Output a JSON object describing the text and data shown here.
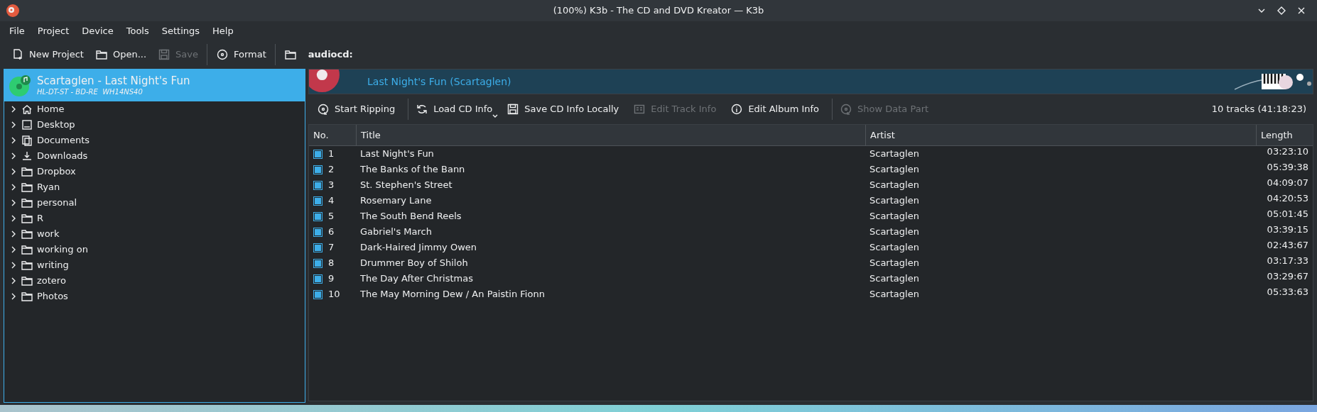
{
  "window": {
    "title": "(100%) K3b - The CD and DVD Kreator — K3b"
  },
  "menu": [
    "File",
    "Project",
    "Device",
    "Tools",
    "Settings",
    "Help"
  ],
  "toolbar": [
    {
      "label": "New Project",
      "disabled": false
    },
    {
      "label": "Open...",
      "disabled": false
    },
    {
      "label": "Save",
      "disabled": true
    },
    {
      "label": "Format",
      "disabled": false
    }
  ],
  "location": "audiocd:",
  "device": {
    "title": "Scartaglen - Last Night's Fun",
    "subtitle": "HL-DT-ST - BD-RE  WH14NS40",
    "selected": true
  },
  "tree": [
    {
      "label": "Home",
      "expanded": false
    },
    {
      "label": "Desktop",
      "expanded": false
    },
    {
      "label": "Documents",
      "expanded": false
    },
    {
      "label": "Downloads",
      "expanded": false
    },
    {
      "label": "Dropbox",
      "expanded": false
    },
    {
      "label": "Ryan",
      "expanded": false
    },
    {
      "label": "personal",
      "expanded": false
    },
    {
      "label": "R",
      "expanded": false
    },
    {
      "label": "work",
      "expanded": false
    },
    {
      "label": "working on",
      "expanded": false
    },
    {
      "label": "writing",
      "expanded": false
    },
    {
      "label": "zotero",
      "expanded": false
    },
    {
      "label": "Photos",
      "expanded": false
    }
  ],
  "banner": {
    "title": "Last Night's Fun (Scartaglen)"
  },
  "cd_toolbar": [
    {
      "label": "Start Ripping",
      "disabled": false,
      "menu": false
    },
    {
      "label": "Load CD Info",
      "disabled": false,
      "menu": true
    },
    {
      "label": "Save CD Info Locally",
      "disabled": false,
      "menu": false
    },
    {
      "label": "Edit Track Info",
      "disabled": true,
      "menu": false
    },
    {
      "label": "Edit Album Info",
      "disabled": false,
      "menu": false
    },
    {
      "label": "Show Data Part",
      "disabled": true,
      "menu": false
    }
  ],
  "summary": "10 tracks (41:18:23)",
  "table": {
    "columns": [
      "No.",
      "Title",
      "Artist",
      "Length"
    ],
    "rows": [
      {
        "checked": true,
        "no": "1",
        "title": "Last Night's Fun",
        "artist": "Scartaglen",
        "length": "03:23:10"
      },
      {
        "checked": true,
        "no": "2",
        "title": "The Banks of the Bann",
        "artist": "Scartaglen",
        "length": "05:39:38"
      },
      {
        "checked": true,
        "no": "3",
        "title": "St. Stephen's Street",
        "artist": "Scartaglen",
        "length": "04:09:07"
      },
      {
        "checked": true,
        "no": "4",
        "title": "Rosemary Lane",
        "artist": "Scartaglen",
        "length": "04:20:53"
      },
      {
        "checked": true,
        "no": "5",
        "title": "The South Bend Reels",
        "artist": "Scartaglen",
        "length": "05:01:45"
      },
      {
        "checked": true,
        "no": "6",
        "title": "Gabriel's March",
        "artist": "Scartaglen",
        "length": "03:39:15"
      },
      {
        "checked": true,
        "no": "7",
        "title": "Dark-Haired Jimmy Owen",
        "artist": "Scartaglen",
        "length": "02:43:67"
      },
      {
        "checked": true,
        "no": "8",
        "title": "Drummer Boy of Shiloh",
        "artist": "Scartaglen",
        "length": "03:17:33"
      },
      {
        "checked": true,
        "no": "9",
        "title": "The Day After Christmas",
        "artist": "Scartaglen",
        "length": "03:29:67"
      },
      {
        "checked": true,
        "no": "10",
        "title": "The May Morning Dew / An Paistin Fionn",
        "artist": "Scartaglen",
        "length": "05:33:63"
      }
    ]
  }
}
